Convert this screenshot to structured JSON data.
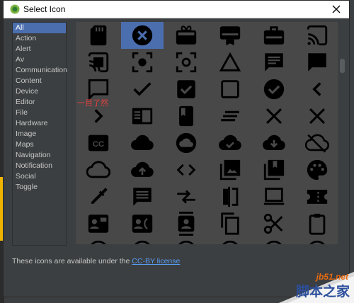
{
  "window": {
    "title": "Select Icon",
    "close_icon": "close-icon"
  },
  "categories": [
    {
      "label": "All",
      "selected": true
    },
    {
      "label": "Action"
    },
    {
      "label": "Alert"
    },
    {
      "label": "Av"
    },
    {
      "label": "Communication"
    },
    {
      "label": "Content"
    },
    {
      "label": "Device"
    },
    {
      "label": "Editor"
    },
    {
      "label": "File"
    },
    {
      "label": "Hardware"
    },
    {
      "label": "Image"
    },
    {
      "label": "Maps"
    },
    {
      "label": "Navigation"
    },
    {
      "label": "Notification"
    },
    {
      "label": "Social"
    },
    {
      "label": "Toggle"
    }
  ],
  "icons": [
    "sd-card-icon",
    "cancel-icon",
    "card-giftcard-icon",
    "card-membership-icon",
    "card-travel-icon",
    "cast-icon",
    "cast-connected-icon",
    "center-focus-strong-icon",
    "center-focus-weak-icon",
    "change-history-icon",
    "chat-icon",
    "chat-bubble-icon",
    "chat-bubble-outline-icon",
    "check-icon",
    "check-box-icon",
    "check-box-outline-blank-icon",
    "check-circle-icon",
    "chevron-left-icon",
    "chevron-right-icon",
    "chrome-reader-mode-icon",
    "class-icon",
    "clear-all-icon",
    "clear-icon",
    "close-icon",
    "closed-caption-icon",
    "cloud-icon",
    "cloud-circle-icon",
    "cloud-done-icon",
    "cloud-download-icon",
    "cloud-off-icon",
    "cloud-queue-icon",
    "cloud-upload-icon",
    "code-icon",
    "collections-icon",
    "collections-bookmark-icon",
    "color-lens-icon",
    "colorize-icon",
    "comment-icon",
    "compare-arrows-icon",
    "compare-icon",
    "computer-icon",
    "confirmation-number-icon",
    "contact-mail-icon",
    "contact-phone-icon",
    "contacts-icon",
    "content-copy-icon",
    "content-cut-icon",
    "content-paste-icon"
  ],
  "selected_icon": "cancel-icon",
  "annotation": "一目了然",
  "footer": {
    "prefix": "These icons are available under the ",
    "link": "CC-BY license"
  },
  "watermark": {
    "site": "jb51.net",
    "name": "脚本之家"
  },
  "colors": {
    "selection": "#4b6eaf",
    "panel": "#484848",
    "link": "#589df6",
    "annotation": "#e04040"
  }
}
